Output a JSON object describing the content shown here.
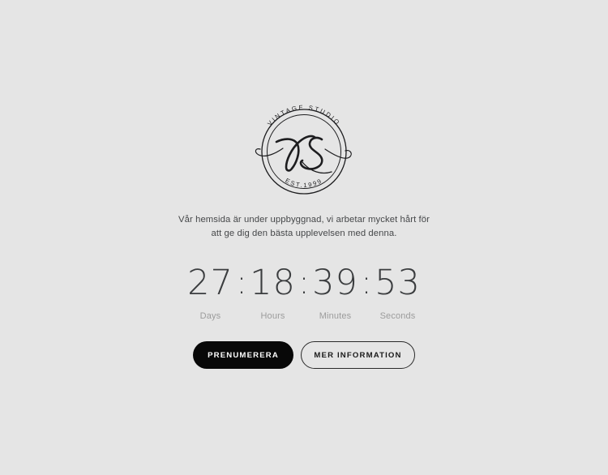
{
  "theme": {
    "background": "#e5e5e5",
    "text_dark": "#46484a",
    "text_muted": "#9c9c9c",
    "accent_black": "#080808",
    "digit_color": "#3b3d3f"
  },
  "logo": {
    "icon": "vintage-studio-monogram",
    "top_arc_text": "VINTAGE STUDIO",
    "bottom_arc_text": "EST.1999",
    "monogram": "VS"
  },
  "intro": {
    "text": "Vår hemsida är under uppbyggnad, vi arbetar mycket hårt för att ge dig den bästa upplevelsen med denna."
  },
  "countdown": {
    "separator": ":",
    "units": [
      {
        "value": "27",
        "label": "Days"
      },
      {
        "value": "18",
        "label": "Hours"
      },
      {
        "value": "39",
        "label": "Minutes"
      },
      {
        "value": "53",
        "label": "Seconds"
      }
    ]
  },
  "buttons": {
    "primary_label": "PRENUMERERA",
    "secondary_label": "MER INFORMATION"
  }
}
